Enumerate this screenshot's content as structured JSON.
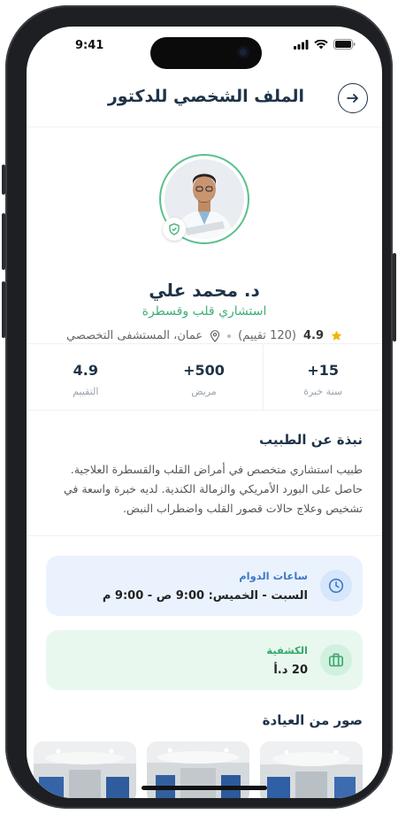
{
  "status": {
    "time": "9:41"
  },
  "header": {
    "title": "الملف الشخصي للدكتور"
  },
  "doctor": {
    "name": "د. محمد علي",
    "specialty": "استشاري قلب وقسطرة",
    "rating": "4.9",
    "reviews": "(120 تقييم)",
    "location": "عمان، المستشفى التخصصي"
  },
  "stats": [
    {
      "value": "15+",
      "label": "سنة خبرة"
    },
    {
      "value": "500+",
      "label": "مريض"
    },
    {
      "value": "4.9",
      "label": "التقييم"
    }
  ],
  "about": {
    "title": "نبذة عن الطبيب",
    "text": "طبيب استشاري متخصص في أمراض القلب والقسطرة العلاجية. حاصل على البورد الأمريكي والزمالة الكندية. لديه خبرة واسعة في تشخيص وعلاج حالات قصور القلب واضطراب النبض."
  },
  "hours": {
    "label": "ساعات الدوام",
    "value": "السبت - الخميس: 9:00 ص - 9:00 م"
  },
  "fee": {
    "label": "الكشفية",
    "value": "20 د.أ"
  },
  "gallery": {
    "title": "صور من العيادة"
  },
  "colors": {
    "accent": "#3fae74",
    "primary": "#1f3348",
    "blue": "#3f78c7"
  }
}
